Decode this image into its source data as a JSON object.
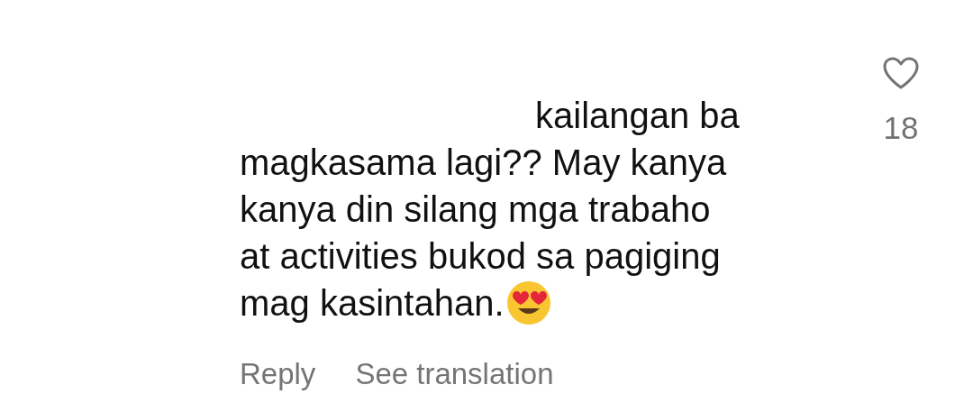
{
  "comment": {
    "text": "kailangan ba\nmagkasama lagi?? May kanya\nkanya din silang mga trabaho\nat activities bukod sa pagiging",
    "text_end": "mag kasintahan.",
    "liked": false,
    "likes": "18"
  },
  "actions": [
    "Reply",
    "See translation"
  ]
}
